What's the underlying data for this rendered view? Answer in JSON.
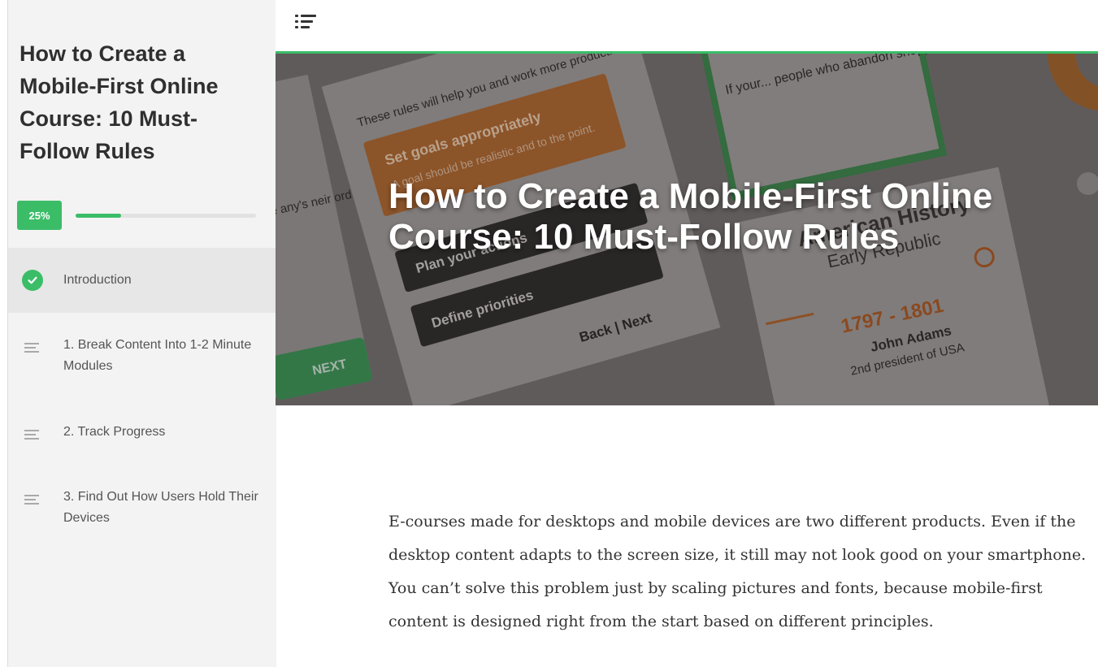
{
  "sidebar": {
    "course_title": "How to Create a Mobile-First Online Course: 10 Must-Follow Rules",
    "progress": {
      "label": "25%",
      "value": 0.25
    },
    "items": [
      {
        "label": "Introduction",
        "state": "completed",
        "icon": "check-circle-icon"
      },
      {
        "label": "1. Break Content Into 1-2 Minute Modules",
        "state": "pending",
        "icon": "lesson-lines-icon"
      },
      {
        "label": "2. Track Progress",
        "state": "pending",
        "icon": "lesson-lines-icon"
      },
      {
        "label": "3. Find Out How Users Hold Their Devices",
        "state": "pending",
        "icon": "lesson-lines-icon"
      }
    ]
  },
  "header": {
    "menu_icon": "menu-lines-icon"
  },
  "hero": {
    "title": "How to Create a Mobile-First Online Course: 10 Must-Follow Rules",
    "texts": {
      "card1_intro": "These rules will help you and work more productively.",
      "goal_title": "Set goals appropriately",
      "goal_body": "A goal should be realistic and to the point.",
      "plan": "Plan your actions",
      "priorities": "Define priorities",
      "back_next": "Back | Next",
      "next_button": "NEXT",
      "cart_text": "If your... people who abandon shopping carts without buying anything...",
      "history_title": "American History",
      "history_subtitle": "Early Republic",
      "years": "1797 - 1801",
      "president_name": "John Adams",
      "president_role": "2nd president of USA",
      "left_fragment": "e any's neir ord it."
    }
  },
  "content": {
    "paragraph": "E-courses made for desktops and mobile devices are two different products. Even if the desktop content adapts to the screen size, it still may not look good on your smartphone. You can’t solve this problem just by scaling pictures and fonts, because mobile-first content is designed right from the start based on different principles."
  },
  "colors": {
    "accent": "#3bbd68",
    "sidebar_bg": "#f3f3f3",
    "active_item_bg": "#e7e7e7",
    "orange": "#e67e22"
  }
}
